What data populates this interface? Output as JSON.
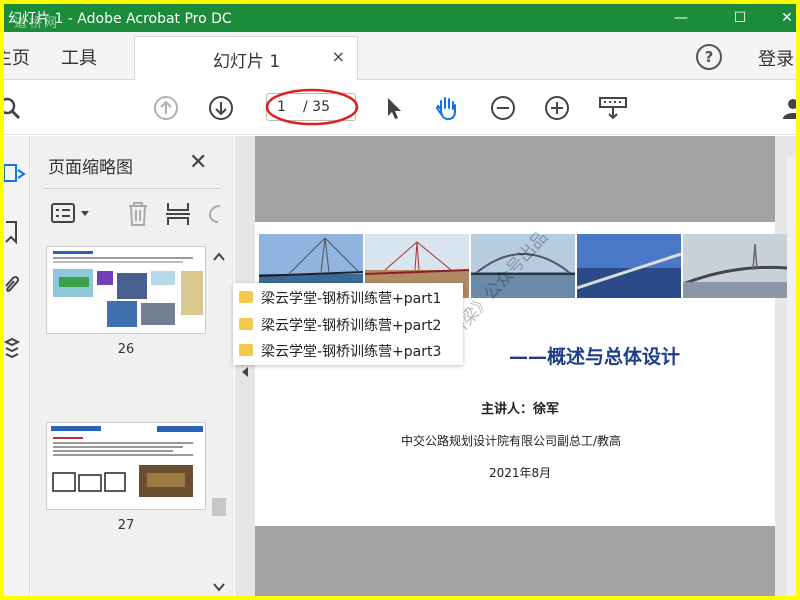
{
  "window": {
    "title": "幻灯片 1 - Adobe Acrobat Pro DC",
    "watermark": "道桥网",
    "controls": [
      "—",
      "☐",
      "✕"
    ]
  },
  "menubar": {
    "home": "主页",
    "tools": "工具",
    "tab_label": "幻灯片 1",
    "tab_close": "×",
    "help": "?",
    "login": "登录"
  },
  "toolbar": {
    "page_current": "1",
    "page_total": "/ 35",
    "icons": [
      "search-icon",
      "page-up-icon",
      "page-down-icon",
      "select-cursor-icon",
      "hand-tool-icon",
      "zoom-out-icon",
      "zoom-in-icon",
      "keyboard-icon",
      "user-icon"
    ]
  },
  "panel": {
    "title": "页面缩略图",
    "close": "✕",
    "thumbnails": [
      {
        "number": "26"
      },
      {
        "number": "27"
      }
    ]
  },
  "bookmarks": [
    {
      "label": "梁云学堂-钢桥训练营+part1"
    },
    {
      "label": "梁云学堂-钢桥训练营+part2"
    },
    {
      "label": "梁云学堂-钢桥训练营+part3"
    }
  ],
  "slide": {
    "title": "——概述与总体设计",
    "presenter": "主讲人：徐军",
    "company": "中交公路规划设计院有限公司副总工/教高",
    "date": "2021年8月",
    "watermark": "《桥梁》公众号出品"
  },
  "colors": {
    "title_bar": "#1c8c3c",
    "hand_tool": "#1473e6",
    "highlight": "#e02020",
    "outer_border": "#ffff00"
  }
}
